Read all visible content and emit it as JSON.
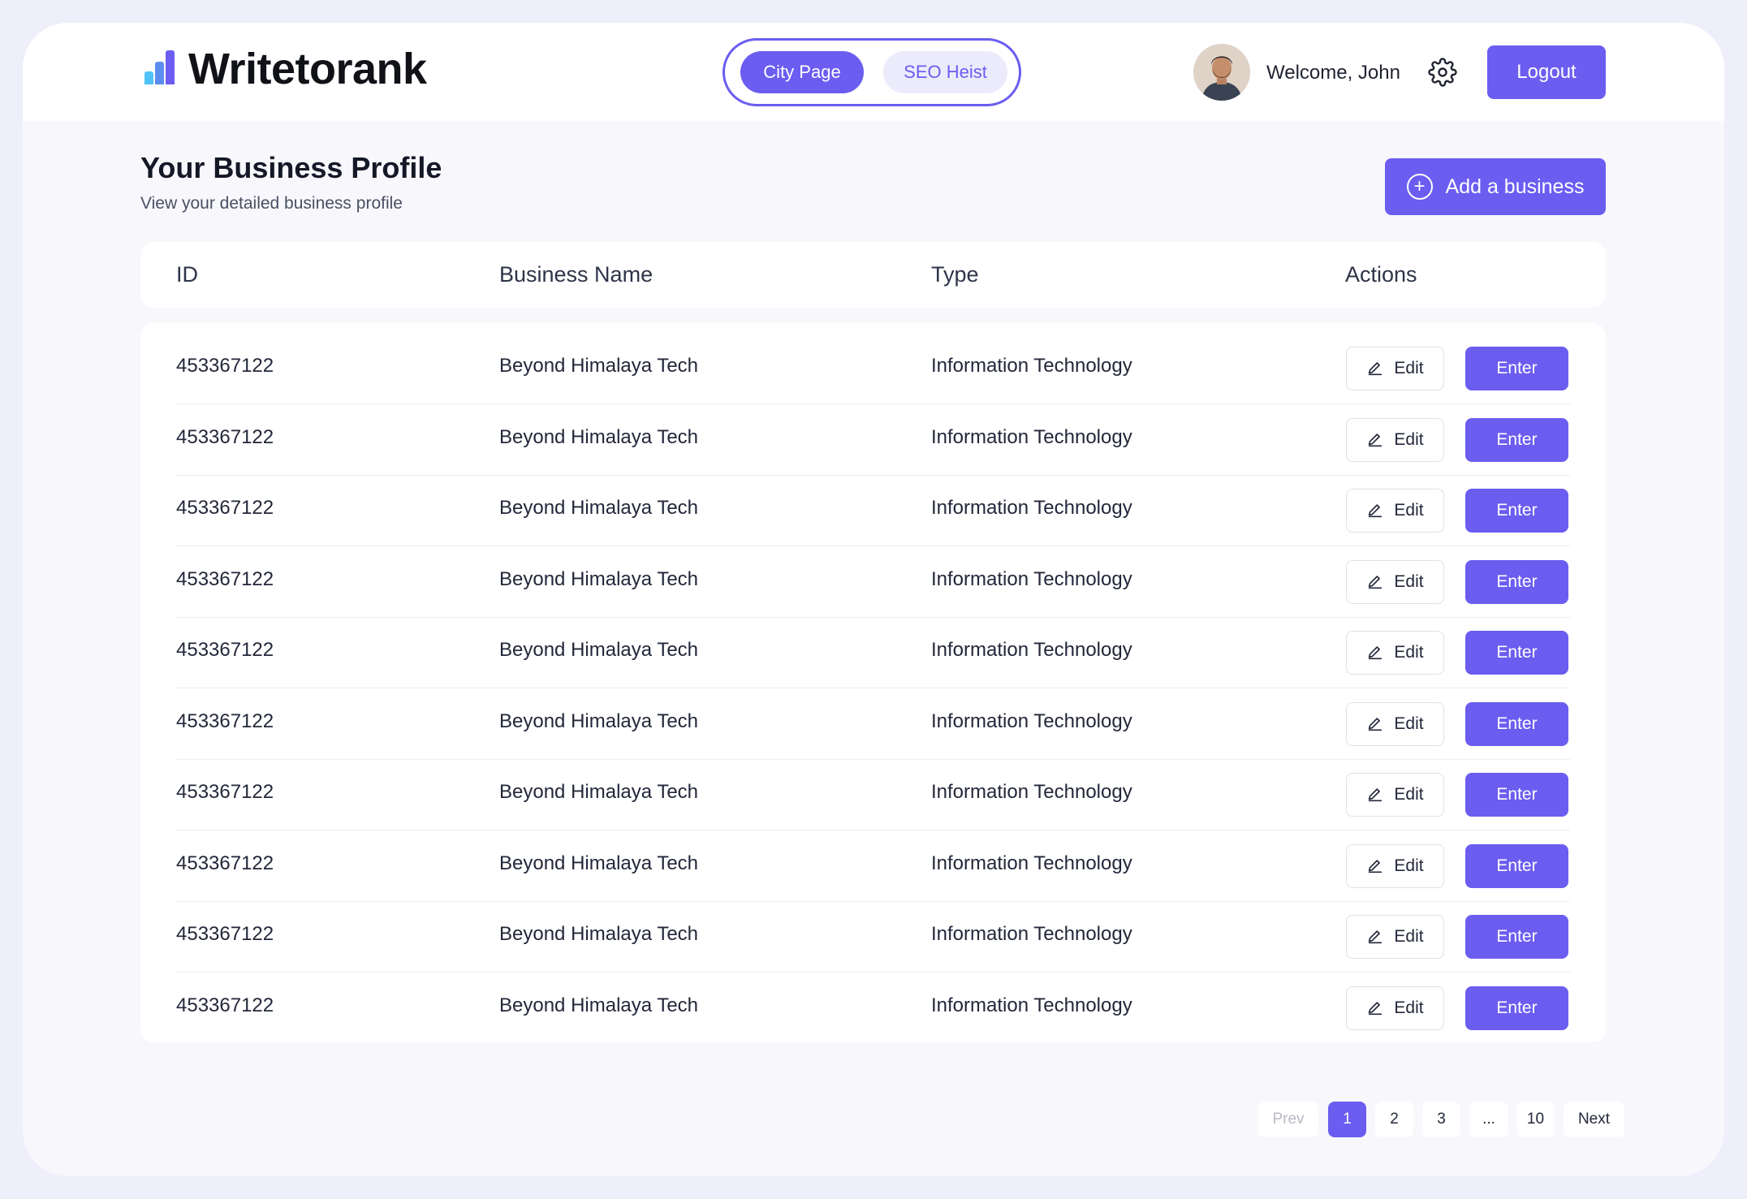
{
  "brand": {
    "name": "Writetorank",
    "colors": {
      "bar1": "#4fc3f7",
      "bar2": "#5b8def",
      "bar3": "#6a5df0"
    }
  },
  "switcher": {
    "active": "City Page",
    "inactive": "SEO Heist"
  },
  "user": {
    "welcome": "Welcome, John",
    "avatar_icon": "user-avatar"
  },
  "header": {
    "settings_icon": "gear-icon",
    "logout": "Logout"
  },
  "page": {
    "title": "Your Business Profile",
    "subtitle": "View your detailed business profile",
    "add_button": "Add a business"
  },
  "table": {
    "columns": [
      "ID",
      "Business Name",
      "Type",
      "Actions"
    ],
    "edit_label": "Edit",
    "enter_label": "Enter",
    "rows": [
      {
        "id": "453367122",
        "name": "Beyond Himalaya Tech",
        "type": "Information Technology"
      },
      {
        "id": "453367122",
        "name": "Beyond Himalaya Tech",
        "type": "Information Technology"
      },
      {
        "id": "453367122",
        "name": "Beyond Himalaya Tech",
        "type": "Information Technology"
      },
      {
        "id": "453367122",
        "name": "Beyond Himalaya Tech",
        "type": "Information Technology"
      },
      {
        "id": "453367122",
        "name": "Beyond Himalaya Tech",
        "type": "Information Technology"
      },
      {
        "id": "453367122",
        "name": "Beyond Himalaya Tech",
        "type": "Information Technology"
      },
      {
        "id": "453367122",
        "name": "Beyond Himalaya Tech",
        "type": "Information Technology"
      },
      {
        "id": "453367122",
        "name": "Beyond Himalaya Tech",
        "type": "Information Technology"
      },
      {
        "id": "453367122",
        "name": "Beyond Himalaya Tech",
        "type": "Information Technology"
      },
      {
        "id": "453367122",
        "name": "Beyond Himalaya Tech",
        "type": "Information Technology"
      }
    ]
  },
  "pagination": {
    "prev": "Prev",
    "pages": [
      "1",
      "2",
      "3",
      "...",
      "10"
    ],
    "current": "1",
    "next": "Next"
  },
  "accent": "#6a5df0"
}
